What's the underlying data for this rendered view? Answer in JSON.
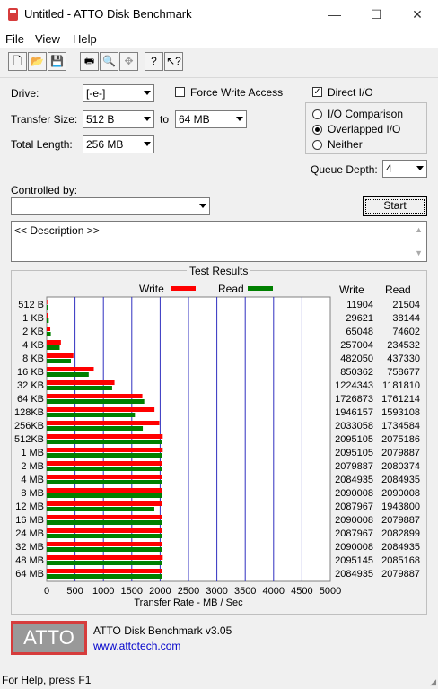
{
  "window": {
    "title": "Untitled - ATTO Disk Benchmark",
    "minimize": "—",
    "maximize": "☐",
    "close": "✕"
  },
  "menu": {
    "items": [
      "File",
      "View",
      "Help"
    ]
  },
  "toolbar": {
    "icons": [
      "new-file-icon",
      "open-folder-icon",
      "save-icon",
      "print-icon",
      "print-preview-icon",
      "move-icon",
      "help-icon",
      "context-help-icon"
    ]
  },
  "form": {
    "drive_label": "Drive:",
    "drive_value": "[-e-]",
    "force_write_label": "Force Write Access",
    "direct_io_label": "Direct I/O",
    "direct_io_checked": true,
    "transfer_size_label": "Transfer Size:",
    "transfer_from": "512 B",
    "to_label": "to",
    "transfer_to": "64 MB",
    "total_length_label": "Total Length:",
    "total_length_value": "256 MB",
    "io_comparison_label": "I/O Comparison",
    "overlapped_io_label": "Overlapped I/O",
    "neither_label": "Neither",
    "queue_depth_label": "Queue Depth:",
    "queue_depth_value": "4",
    "controlled_by_label": "Controlled by:",
    "controlled_by_value": "",
    "start_label": "Start",
    "description_text": "<< Description >>"
  },
  "results": {
    "group_title": "Test Results",
    "write_legend": "Write",
    "read_legend": "Read",
    "write_header": "Write",
    "read_header": "Read",
    "write_color": "#ff0000",
    "read_color": "#008000"
  },
  "chart_data": {
    "type": "bar",
    "orientation": "horizontal",
    "xlabel": "Transfer Rate - MB / Sec",
    "xlim": [
      0,
      5000
    ],
    "xticks": [
      "0",
      "500",
      "1000",
      "1500",
      "2000",
      "2500",
      "3000",
      "3500",
      "4000",
      "4500",
      "5000"
    ],
    "grid": true,
    "categories": [
      "512 B",
      "1 KB",
      "2 KB",
      "4 KB",
      "8 KB",
      "16 KB",
      "32 KB",
      "64 KB",
      "128KB",
      "256KB",
      "512KB",
      "1 MB",
      "2 MB",
      "4 MB",
      "8 MB",
      "12 MB",
      "16 MB",
      "24 MB",
      "32 MB",
      "48 MB",
      "64 MB"
    ],
    "series": [
      {
        "name": "Write",
        "values_kb": [
          11904,
          29621,
          65048,
          257004,
          482050,
          850362,
          1224343,
          1726873,
          1946157,
          2033058,
          2095105,
          2095105,
          2079887,
          2084935,
          2090008,
          2087967,
          2090008,
          2087967,
          2090008,
          2095145,
          2084935
        ]
      },
      {
        "name": "Read",
        "values_kb": [
          21504,
          38144,
          74602,
          234532,
          437330,
          758677,
          1181810,
          1761214,
          1593108,
          1734584,
          2075186,
          2079887,
          2080374,
          2084935,
          2090008,
          1943800,
          2079887,
          2082899,
          2084935,
          2085168,
          2079887
        ]
      }
    ]
  },
  "footer": {
    "logo_text": "ATTO",
    "product": "ATTO Disk Benchmark v3.05",
    "url": "www.attotech.com"
  },
  "status": {
    "text": "For Help, press F1"
  }
}
